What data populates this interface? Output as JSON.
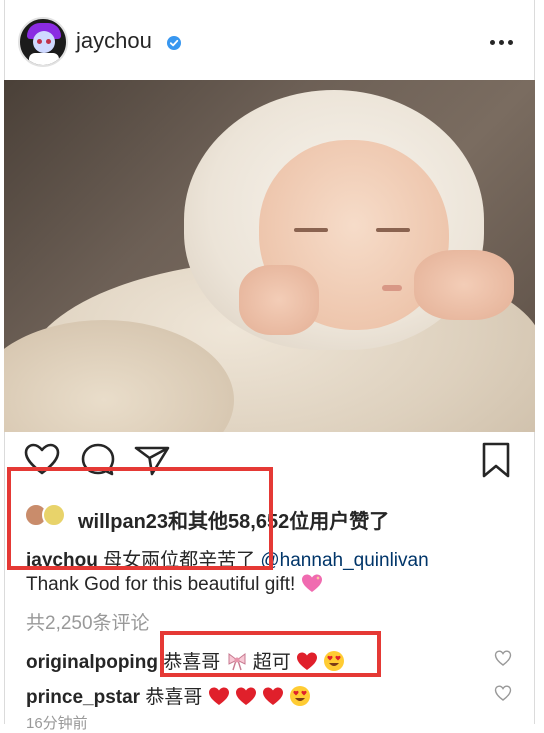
{
  "post": {
    "username": "jaychou",
    "verified": true
  },
  "likes": {
    "text": "willpan23和其他58,652位用户赞了"
  },
  "caption": {
    "username": "jaychou",
    "text": "母女兩位都辛苦了",
    "mention": "@hannah_quinlivan",
    "line2": "Thank God for this beautiful gift!"
  },
  "comments_count": "共2,250条评论",
  "comments": [
    {
      "username": "originalpoping",
      "text_a": "恭喜哥",
      "text_b": "超可"
    },
    {
      "username": "prince_pstar",
      "text": "恭喜哥"
    }
  ],
  "timestamp": "16分钟前",
  "icons": [
    "verified-badge",
    "more-icon",
    "heart-icon",
    "comment-icon",
    "share-icon",
    "bookmark-icon",
    "sparkling-heart-emoji",
    "red-heart-emoji",
    "heart-eyes-emoji",
    "ribbon-emoji"
  ],
  "colors": {
    "highlight_box": "#e53935",
    "verified_blue": "#3897f0",
    "mention": "#003569"
  }
}
